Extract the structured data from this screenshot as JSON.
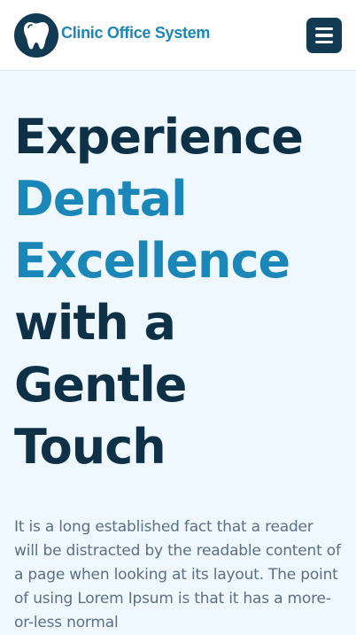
{
  "header": {
    "brand_name": "Clinic Office System",
    "logo_icon": "tooth-icon",
    "menu_icon": "hamburger-menu-icon"
  },
  "hero": {
    "title_lines": [
      {
        "text": "Experience",
        "accent": false
      },
      {
        "text": "Dental",
        "accent": true
      },
      {
        "text": "Excellence",
        "accent": true
      },
      {
        "text": "with a",
        "accent": false
      },
      {
        "text": "Gentle",
        "accent": false
      },
      {
        "text": "Touch",
        "accent": false
      }
    ],
    "description": "It is a long established fact that a reader will be distracted by the readable content of a page when looking at its layout. The point of using Lorem Ipsum is that it has a more-or-less normal"
  },
  "colors": {
    "brand_dark": "#123a52",
    "accent": "#1b86b8",
    "title": "#0f3147",
    "body_text": "#5b6f86",
    "page_background": "#f0f8ff"
  }
}
